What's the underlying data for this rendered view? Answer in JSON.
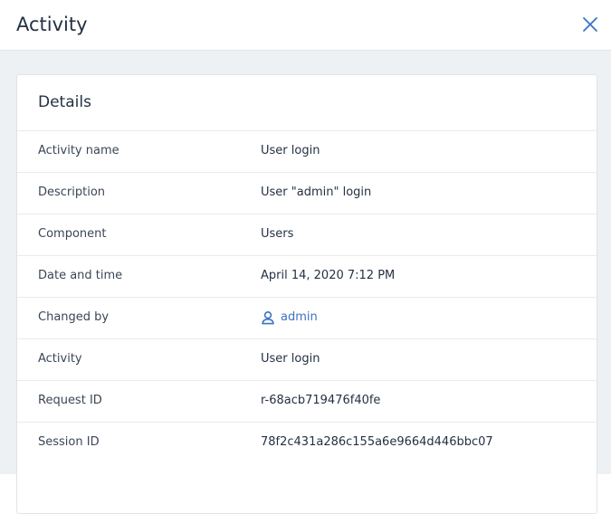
{
  "header": {
    "title": "Activity",
    "close_icon": "close-icon"
  },
  "card": {
    "title": "Details",
    "rows": [
      {
        "label": "Activity name",
        "value": "User login"
      },
      {
        "label": "Description",
        "value": "User \"admin\" login"
      },
      {
        "label": "Component",
        "value": "Users"
      },
      {
        "label": "Date and time",
        "value": "April 14, 2020 7:12 PM"
      },
      {
        "label": "Changed by",
        "value": "admin",
        "icon": "user-icon"
      },
      {
        "label": "Activity",
        "value": "User login"
      },
      {
        "label": "Request ID",
        "value": "r-68acb719476f40fe"
      },
      {
        "label": "Session ID",
        "value": "78f2c431a286c155a6e9664d446bbc07"
      }
    ]
  },
  "colors": {
    "accent": "#3b73c3",
    "background": "#eef1f4",
    "text": "#243143"
  }
}
